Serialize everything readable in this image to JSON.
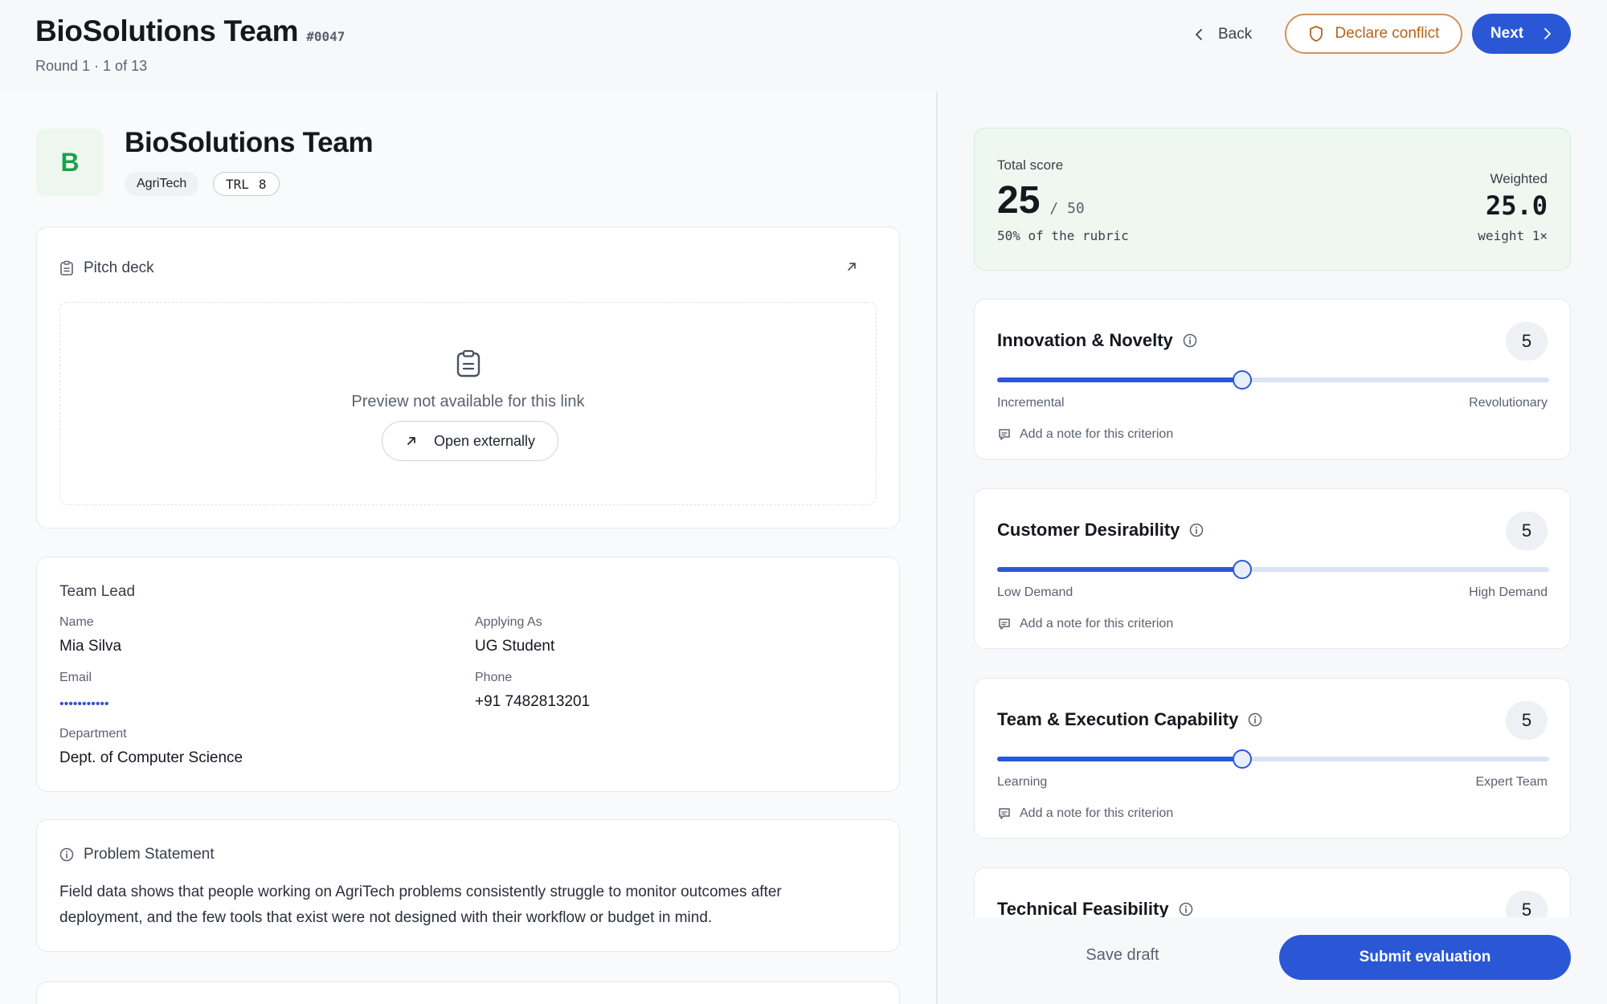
{
  "header": {
    "title": "BioSolutions Team",
    "id": "#0047",
    "subtitle": "Round 1 · 1 of 13",
    "back_label": "Back",
    "conflict_label": "Declare conflict",
    "next_label": "Next"
  },
  "team": {
    "initial": "B",
    "name": "BioSolutions Team",
    "sector": "AgriTech",
    "trl_label": "TRL",
    "trl_value": "8"
  },
  "pitch": {
    "title": "Pitch deck",
    "preview_text": "Preview not available for this link",
    "open_label": "Open externally"
  },
  "lead": {
    "title": "Team Lead",
    "name_label": "Name",
    "name": "Mia Silva",
    "applying_label": "Applying As",
    "applying": "UG Student",
    "email_label": "Email",
    "email_masked": "•••••••••••",
    "phone_label": "Phone",
    "phone": "+91 7482813201",
    "dept_label": "Department",
    "dept": "Dept. of Computer Science"
  },
  "problem": {
    "title": "Problem Statement",
    "text": "Field data shows that people working on AgriTech problems consistently struggle to monitor outcomes after deployment, and the few tools that exist were not designed with their workflow or budget in mind."
  },
  "score": {
    "label": "Total score",
    "total": "25",
    "of": "/ 50",
    "pct": "50% of the rubric",
    "weighted_label": "Weighted",
    "weighted_value": "25.0",
    "weight": "weight 1×"
  },
  "criteria": [
    {
      "title": "Innovation & Novelty",
      "score": "5",
      "level": 0.444,
      "low": "Incremental",
      "high": "Revolutionary",
      "note": "Add a note for this criterion"
    },
    {
      "title": "Customer Desirability",
      "score": "5",
      "level": 0.444,
      "low": "Low Demand",
      "high": "High Demand",
      "note": "Add a note for this criterion"
    },
    {
      "title": "Team & Execution Capability",
      "score": "5",
      "level": 0.444,
      "low": "Learning",
      "high": "Expert Team",
      "note": "Add a note for this criterion"
    },
    {
      "title": "Technical Feasibility",
      "score": "5"
    }
  ],
  "footer": {
    "draft_label": "Save draft",
    "submit_label": "Submit evaluation"
  },
  "colors": {
    "accent": "#2a57d6",
    "conflict": "#b5631a",
    "score_bg": "#eef8f0",
    "avatar_green": "#1ea04a"
  }
}
